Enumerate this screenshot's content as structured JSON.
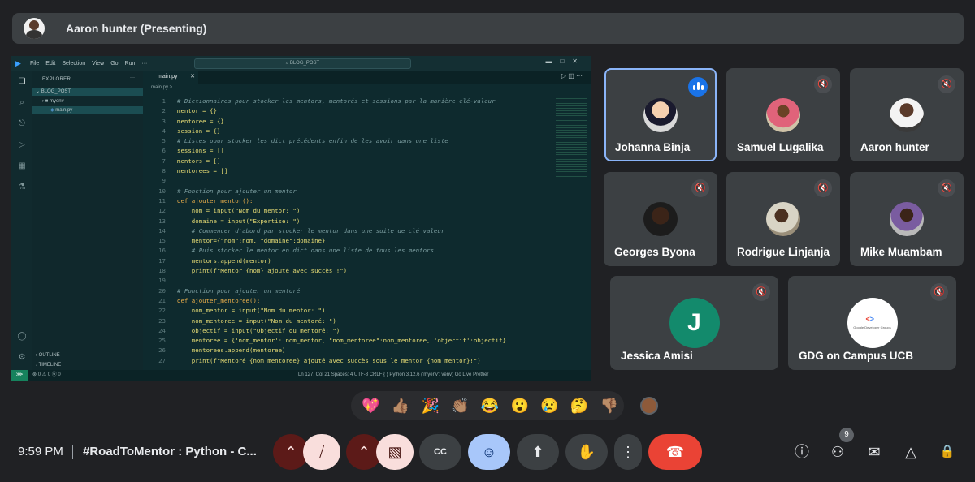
{
  "presenter": {
    "name": "Aaron hunter (Presenting)"
  },
  "vscode": {
    "menu": [
      "File",
      "Edit",
      "Selection",
      "View",
      "Go",
      "Run",
      "···"
    ],
    "search": "BLOG_POST",
    "explorer_title": "EXPLORER",
    "explorer_more": "···",
    "root_folder": "BLOG_POST",
    "items": [
      "myenv",
      "main.py"
    ],
    "outline": "OUTLINE",
    "timeline": "TIMELINE",
    "tab": "main.py",
    "breadcrumb": "main.py > ...",
    "lines": [
      {
        "n": "1",
        "t": "# Dictionnaires pour stocker les mentors, mentorés et sessions par la manière clé-valeur",
        "c": "comment"
      },
      {
        "n": "2",
        "t": "mentor = {}",
        "c": ""
      },
      {
        "n": "3",
        "t": "mentoree = {}",
        "c": ""
      },
      {
        "n": "4",
        "t": "session = {}",
        "c": ""
      },
      {
        "n": "5",
        "t": "# Listes pour stocker les dict précédents enfin de les avoir dans une liste",
        "c": "comment"
      },
      {
        "n": "6",
        "t": "sessions = []",
        "c": ""
      },
      {
        "n": "7",
        "t": "mentors = []",
        "c": ""
      },
      {
        "n": "8",
        "t": "mentorees = []",
        "c": ""
      },
      {
        "n": "9",
        "t": "",
        "c": ""
      },
      {
        "n": "10",
        "t": "# Fonction pour ajouter un mentor",
        "c": "comment"
      },
      {
        "n": "11",
        "t": "def ajouter_mentor():",
        "c": "kw"
      },
      {
        "n": "12",
        "t": "    nom = input(\"Nom du mentor: \")",
        "c": ""
      },
      {
        "n": "13",
        "t": "    domaine = input(\"Expertise: \")",
        "c": ""
      },
      {
        "n": "14",
        "t": "    # Commencer d'abord par stocker le mentor dans une suite de clé valeur",
        "c": "comment"
      },
      {
        "n": "15",
        "t": "    mentor={\"nom\":nom, \"domaine\":domaine}",
        "c": ""
      },
      {
        "n": "16",
        "t": "    # Puis stocker le mentor en dict dans une liste de tous les mentors",
        "c": "comment"
      },
      {
        "n": "17",
        "t": "    mentors.append(mentor)",
        "c": ""
      },
      {
        "n": "18",
        "t": "    print(f\"Mentor {nom} ajouté avec succès !\")",
        "c": ""
      },
      {
        "n": "19",
        "t": "",
        "c": ""
      },
      {
        "n": "20",
        "t": "# Fonction pour ajouter un mentoré",
        "c": "comment"
      },
      {
        "n": "21",
        "t": "def ajouter_mentoree():",
        "c": "kw"
      },
      {
        "n": "22",
        "t": "    nom_mentor = input(\"Nom du mentor: \")",
        "c": ""
      },
      {
        "n": "23",
        "t": "    nom_mentoree = input(\"Nom du mentoré: \")",
        "c": ""
      },
      {
        "n": "24",
        "t": "    objectif = input(\"Objectif du mentoré: \")",
        "c": ""
      },
      {
        "n": "25",
        "t": "    mentoree = {'nom_mentor': nom_mentor, \"nom_mentoree\":nom_mentoree, 'objectif':objectif}",
        "c": ""
      },
      {
        "n": "26",
        "t": "    mentorees.append(mentoree)",
        "c": ""
      },
      {
        "n": "27",
        "t": "    print(f\"Mentoré {nom_mentoree} ajouté avec succès sous le mentor {nom_mentor}!\")",
        "c": ""
      }
    ],
    "status_left": "⊗ 0 ⚠ 0   ⓦ 0",
    "status_right": "Ln 127, Col 21   Spaces: 4   UTF-8   CRLF   { } Python   3.12.6 ('myenv': venv)   Go Live   Prettier"
  },
  "participants": [
    {
      "name": "Johanna Binja",
      "state": "speaking"
    },
    {
      "name": "Samuel Lugalika",
      "state": "muted"
    },
    {
      "name": "Aaron hunter",
      "state": "muted"
    },
    {
      "name": "Georges Byona",
      "state": "muted"
    },
    {
      "name": "Rodrigue Linjanja",
      "state": "muted"
    },
    {
      "name": "Mike Muambam",
      "state": "muted"
    },
    {
      "name": "Jessica Amisi",
      "state": "muted",
      "initial": "J"
    },
    {
      "name": "GDG on Campus UCB",
      "state": "muted",
      "logo_text": "Google Developer Groups"
    }
  ],
  "reactions": [
    "💖",
    "👍🏽",
    "🎉",
    "👏🏽",
    "😂",
    "😮",
    "😢",
    "🤔",
    "👎🏽"
  ],
  "bottom": {
    "time": "9:59 PM",
    "title": "#RoadToMentor : Python - C...",
    "people_count": "9"
  },
  "icons": {
    "chevron_up": "⌃",
    "mic_off": "🎙",
    "cam_off": "▧",
    "captions": "CC",
    "emoji": "☺",
    "present": "⬆",
    "raise_hand": "✋",
    "more": "⋮",
    "end_call": "☎",
    "info": "ⓘ",
    "people": "⚇",
    "chat": "✉",
    "activities": "△",
    "host": "🔒"
  },
  "colors": {
    "speaking_outline": "#8ab4f8",
    "end_call": "#ea4335",
    "reaction_active": "#a8c7fa"
  }
}
